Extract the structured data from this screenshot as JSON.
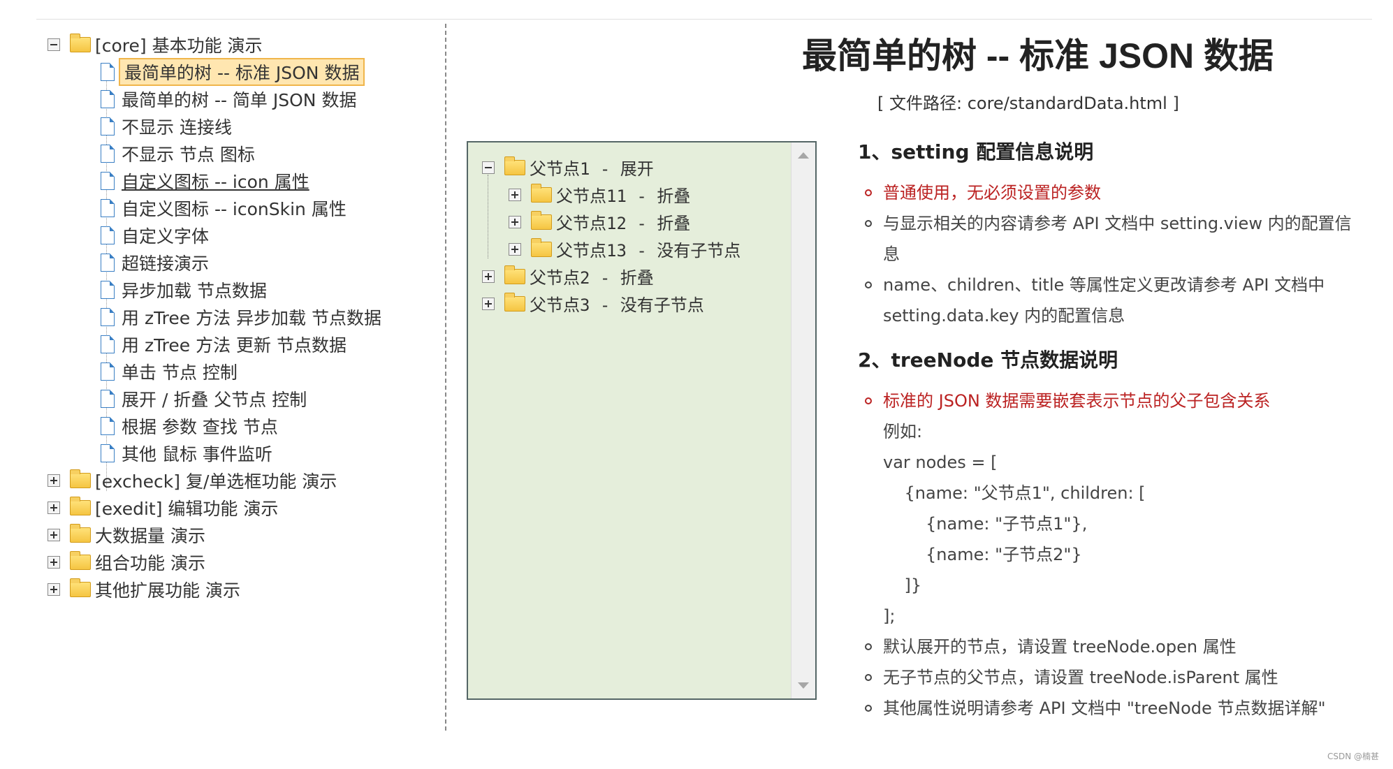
{
  "nav": {
    "core": {
      "label": "[core] 基本功能 演示",
      "items": [
        "最简单的树 -- 标准 JSON 数据",
        "最简单的树 -- 简单 JSON 数据",
        "不显示 连接线",
        "不显示 节点 图标",
        "自定义图标 -- icon 属性",
        "自定义图标 -- iconSkin 属性",
        "自定义字体",
        "超链接演示",
        "异步加载 节点数据",
        "用 zTree 方法 异步加载 节点数据",
        "用 zTree 方法 更新 节点数据",
        "单击 节点 控制",
        "展开 / 折叠 父节点 控制",
        "根据 参数 查找 节点",
        "其他 鼠标 事件监听"
      ]
    },
    "groups": [
      "[excheck] 复/单选框功能 演示",
      "[exedit] 编辑功能 演示",
      "大数据量 演示",
      "组合功能 演示",
      "其他扩展功能 演示"
    ]
  },
  "demo_tree": [
    "父节点1 - 展开",
    "父节点11 - 折叠",
    "父节点12 - 折叠",
    "父节点13 - 没有子节点",
    "父节点2 - 折叠",
    "父节点3 - 没有子节点"
  ],
  "doc": {
    "title": "最简单的树 -- 标准 JSON 数据",
    "path": "[ 文件路径: core/standardData.html ]",
    "section1": {
      "heading": "1、setting 配置信息说明",
      "items": [
        "普通使用，无必须设置的参数",
        "与显示相关的内容请参考 API 文档中 setting.view 内的配置信息",
        "name、children、title 等属性定义更改请参考 API 文档中 setting.data.key 内的配置信息"
      ]
    },
    "section2": {
      "heading": "2、treeNode 节点数据说明",
      "item1": "标准的 JSON 数据需要嵌套表示节点的父子包含关系",
      "example_label": "例如:",
      "code": [
        "var nodes = [",
        "    {name: \"父节点1\", children: [",
        "        {name: \"子节点1\"},",
        "        {name: \"子节点2\"}",
        "    ]}",
        "];"
      ],
      "items": [
        "默认展开的节点，请设置 treeNode.open 属性",
        "无子节点的父节点，请设置 treeNode.isParent 属性",
        "其他属性说明请参考 API 文档中 \"treeNode 节点数据详解\""
      ]
    }
  },
  "watermark": "CSDN @楠甚"
}
